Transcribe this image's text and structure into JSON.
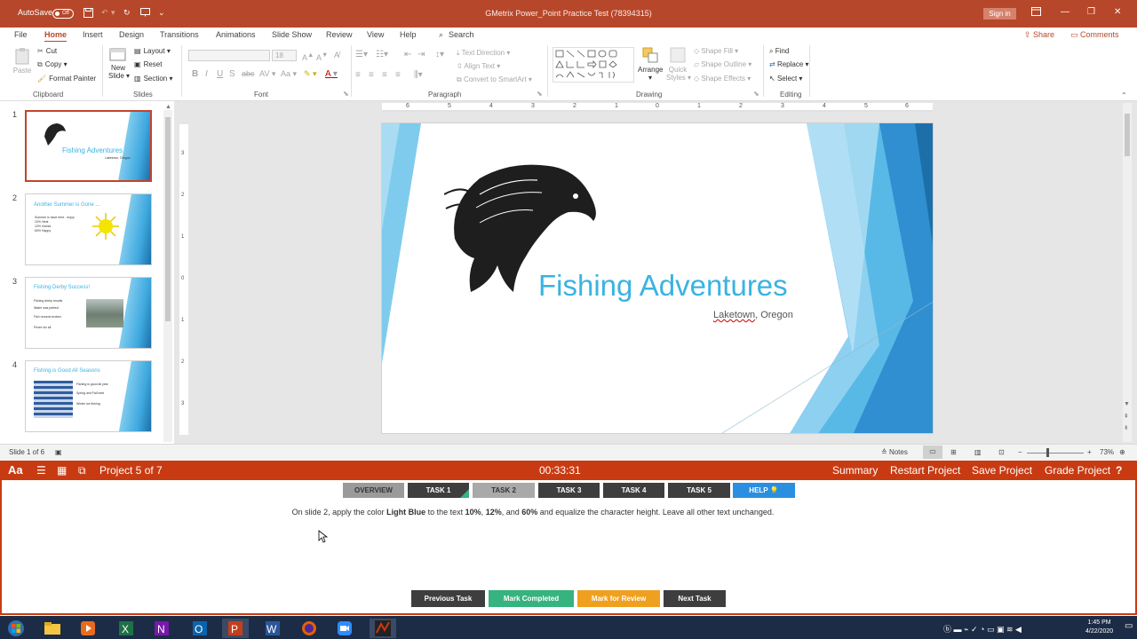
{
  "titlebar": {
    "autosave_label": "AutoSave",
    "autosave_state": "Off",
    "title": "GMetrix Power_Point Practice Test (78394315)",
    "signin_label": "Sign in"
  },
  "menubar": {
    "tabs": [
      "File",
      "Home",
      "Insert",
      "Design",
      "Transitions",
      "Animations",
      "Slide Show",
      "Review",
      "View",
      "Help"
    ],
    "active_tab": "Home",
    "search_label": "Search",
    "share_label": "Share",
    "comments_label": "Comments"
  },
  "ribbon": {
    "clipboard": {
      "paste": "Paste",
      "cut": "Cut",
      "copy": "Copy",
      "format_painter": "Format Painter",
      "label": "Clipboard"
    },
    "slides": {
      "new_slide_1": "New",
      "new_slide_2": "Slide",
      "layout": "Layout",
      "reset": "Reset",
      "section": "Section",
      "label": "Slides"
    },
    "font": {
      "size": "18",
      "label": "Font"
    },
    "paragraph": {
      "text_direction": "Text Direction",
      "align_text": "Align Text",
      "convert_smartart": "Convert to SmartArt",
      "label": "Paragraph"
    },
    "drawing": {
      "arrange": "Arrange",
      "quick_styles_1": "Quick",
      "quick_styles_2": "Styles",
      "shape_fill": "Shape Fill",
      "shape_outline": "Shape Outline",
      "shape_effects": "Shape Effects",
      "label": "Drawing"
    },
    "editing": {
      "find": "Find",
      "replace": "Replace",
      "select": "Select",
      "label": "Editing"
    }
  },
  "thumbnails": [
    {
      "num": "1",
      "title": "Fishing Adventures",
      "sub": "Laketown, Oregon"
    },
    {
      "num": "2",
      "title": "Another Summer is Gone ...",
      "lines": [
        "Summer is have here - enjoy",
        "10% Heat",
        "12% Humid",
        "60% Happy"
      ]
    },
    {
      "num": "3",
      "title": "Fishing Derby Success!",
      "lines": [
        "Fishing derby results",
        "Water was perfect",
        "Fish records broken",
        "Prizes for all"
      ]
    },
    {
      "num": "4",
      "title": "Fishing is Good All Seasons",
      "lines": [
        "Fishing is good all year",
        "Spring and Fall best",
        "Winter ice fishing"
      ]
    }
  ],
  "slide": {
    "title": "Fishing Adventures",
    "subtitle_word1": "Laketown",
    "subtitle_rest": ", Oregon"
  },
  "ruler_h": [
    "6",
    "5",
    "4",
    "3",
    "2",
    "1",
    "0",
    "1",
    "2",
    "3",
    "4",
    "5",
    "6"
  ],
  "ruler_v": [
    "3",
    "2",
    "1",
    "0",
    "1",
    "2",
    "3"
  ],
  "statusbar": {
    "slide_info": "Slide 1 of 6",
    "notes": "Notes",
    "zoom": "73%"
  },
  "gmetrix": {
    "project": "Project 5 of 7",
    "timer": "00:33:31",
    "summary": "Summary",
    "restart": "Restart Project",
    "save": "Save Project",
    "grade": "Grade Project",
    "help_icon": "?"
  },
  "tasks": {
    "overview": "OVERVIEW",
    "task1": "TASK 1",
    "task2": "TASK 2",
    "task3": "TASK 3",
    "task4": "TASK 4",
    "task5": "TASK 5",
    "help": "HELP"
  },
  "instruction": {
    "p1": "On slide 2, apply the color ",
    "b1": "Light Blue",
    "p2": " to the text ",
    "b2": "10%",
    "p3": ", ",
    "b3": "12%",
    "p4": ", and ",
    "b4": "60%",
    "p5": " and equalize the character height. Leave all other text unchanged."
  },
  "footer": {
    "previous": "Previous Task",
    "mark_completed": "Mark Completed",
    "mark_review": "Mark for Review",
    "next": "Next Task"
  },
  "taskbar": {
    "time": "1:45 PM",
    "date": "4/22/2020",
    "apps": [
      "start-icon",
      "file-explorer-icon",
      "media-player-icon",
      "excel-icon",
      "onenote-icon",
      "outlook-icon",
      "powerpoint-icon",
      "word-icon",
      "firefox-icon",
      "zoom-icon",
      "gmetrix-icon"
    ]
  },
  "colors": {
    "powerpoint_red": "#b7472a",
    "gmetrix_red": "#c83b12",
    "slide_accent": "#3ab3e2",
    "task_green": "#36b37e",
    "task_orange": "#f0a020",
    "help_blue": "#2a8fe0"
  }
}
